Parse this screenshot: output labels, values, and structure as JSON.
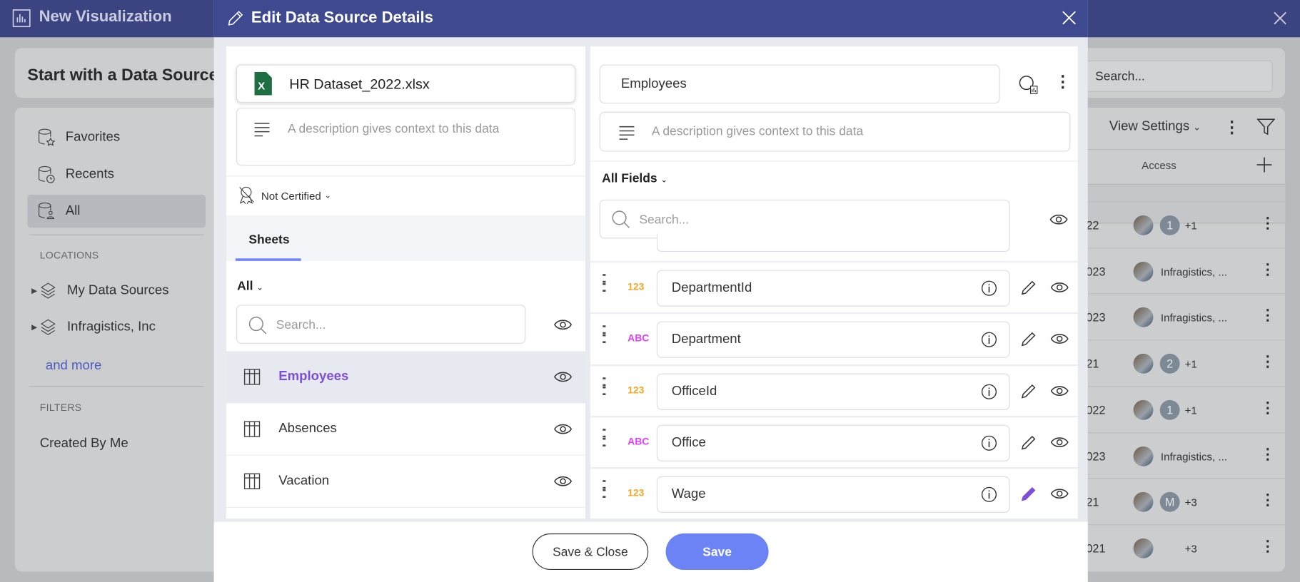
{
  "app": {
    "title": "New Visualization",
    "subtitle": "Start with a Data Source",
    "search_placeholder": "Search...",
    "sidebar": {
      "items": [
        {
          "label": "Favorites"
        },
        {
          "label": "Recents"
        },
        {
          "label": "All"
        }
      ],
      "locations_label": "LOCATIONS",
      "locations": [
        {
          "label": "My Data Sources"
        },
        {
          "label": "Infragistics, Inc"
        }
      ],
      "and_more": "and more",
      "filters_label": "FILTERS",
      "filters": [
        {
          "label": "Created By Me"
        }
      ]
    },
    "toolbar": {
      "view_settings": "View Settings"
    },
    "table": {
      "access_header": "Access",
      "rows": [
        {
          "date": "22",
          "access": "+1",
          "badge": "1"
        },
        {
          "date": "023",
          "access": "Infragistics, ..."
        },
        {
          "date": "023",
          "access": "Infragistics, ..."
        },
        {
          "date": "21",
          "access": "+1",
          "badge": "2"
        },
        {
          "date": "022",
          "access": "+1",
          "badge": "1"
        },
        {
          "date": "023",
          "access": "Infragistics, ..."
        },
        {
          "date": "21",
          "access": "+3",
          "badge": "M"
        },
        {
          "date": "021",
          "access": "+3"
        }
      ]
    }
  },
  "modal": {
    "title": "Edit Data Source Details",
    "left": {
      "file_name": "HR Dataset_2022.xlsx",
      "description_placeholder": "A description gives context to this data",
      "certification": "Not Certified",
      "tab": "Sheets",
      "filter": "All",
      "search_placeholder": "Search...",
      "sheets": [
        {
          "name": "Employees",
          "selected": true
        },
        {
          "name": "Absences"
        },
        {
          "name": "Vacation"
        }
      ]
    },
    "right": {
      "name": "Employees",
      "description_placeholder": "A description gives context to this data",
      "filter": "All Fields",
      "search_placeholder": "Search...",
      "fields": [
        {
          "type": "123",
          "name": "DepartmentId"
        },
        {
          "type": "ABC",
          "name": "Department"
        },
        {
          "type": "123",
          "name": "OfficeId"
        },
        {
          "type": "ABC",
          "name": "Office"
        },
        {
          "type": "123",
          "name": "Wage",
          "editing": true
        }
      ]
    },
    "footer": {
      "save_close": "Save & Close",
      "save": "Save"
    }
  },
  "colors": {
    "header": "#3e4990",
    "accent": "#6b83f5",
    "selected_text": "#7b4fd8",
    "number_type": "#f5a623",
    "text_type": "#e040fb",
    "excel": "#1d6f42"
  }
}
